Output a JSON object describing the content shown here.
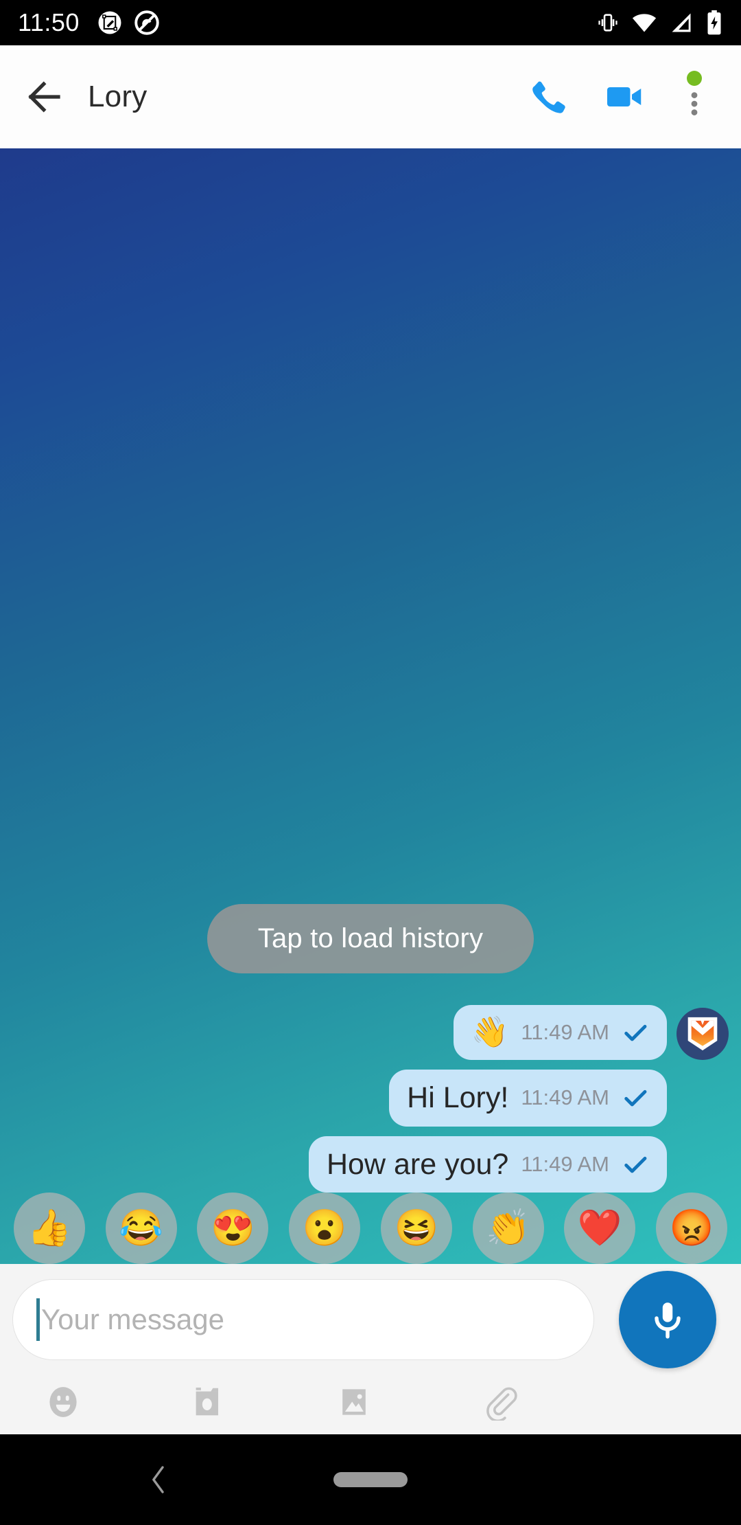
{
  "statusbar": {
    "time": "11:50",
    "left_icons": [
      "screenshot-markup-icon",
      "do-not-disturb-icon"
    ],
    "right_icons": [
      "vibrate-icon",
      "wifi-icon",
      "cellular-signal-icon",
      "battery-charging-icon"
    ]
  },
  "appbar": {
    "back_label": "back-arrow",
    "title": "Lory",
    "call_label": "Voice call",
    "video_label": "Video call",
    "overflow_label": "More options",
    "status_dot_color": "#76bc21",
    "accent_color": "#1e9af2"
  },
  "chat": {
    "load_history_label": "Tap to load history",
    "messages": [
      {
        "text": "",
        "emoji": "👋",
        "time": "11:49 AM",
        "status": "sent-check",
        "has_avatar": true
      },
      {
        "text": "Hi Lory!",
        "emoji": "",
        "time": "11:49 AM",
        "status": "sent-check",
        "has_avatar": false
      },
      {
        "text": "How are you?",
        "emoji": "",
        "time": "11:49 AM",
        "status": "sent-check",
        "has_avatar": false
      }
    ],
    "bubble_color": "#c8e5f9",
    "tick_color": "#1175bc",
    "background_top": "#1f3b8c",
    "background_bottom": "#2fc0bd"
  },
  "emoji_bar": {
    "items": [
      {
        "name": "thumbs-up",
        "glyph": "👍"
      },
      {
        "name": "joy",
        "glyph": "😂"
      },
      {
        "name": "heart-eyes",
        "glyph": "😍"
      },
      {
        "name": "surprised",
        "glyph": "😮"
      },
      {
        "name": "laughing",
        "glyph": "😆"
      },
      {
        "name": "clap",
        "glyph": "👏"
      },
      {
        "name": "red-heart",
        "glyph": "❤️"
      },
      {
        "name": "angry",
        "glyph": "😡"
      }
    ]
  },
  "composer": {
    "placeholder": "Your message",
    "value": "",
    "mic_label": "Record voice message",
    "attachments": [
      "emoji-icon",
      "camera-icon",
      "gallery-icon",
      "paperclip-icon"
    ]
  },
  "navbar": {
    "back_label": "Back",
    "home_label": "Home"
  }
}
